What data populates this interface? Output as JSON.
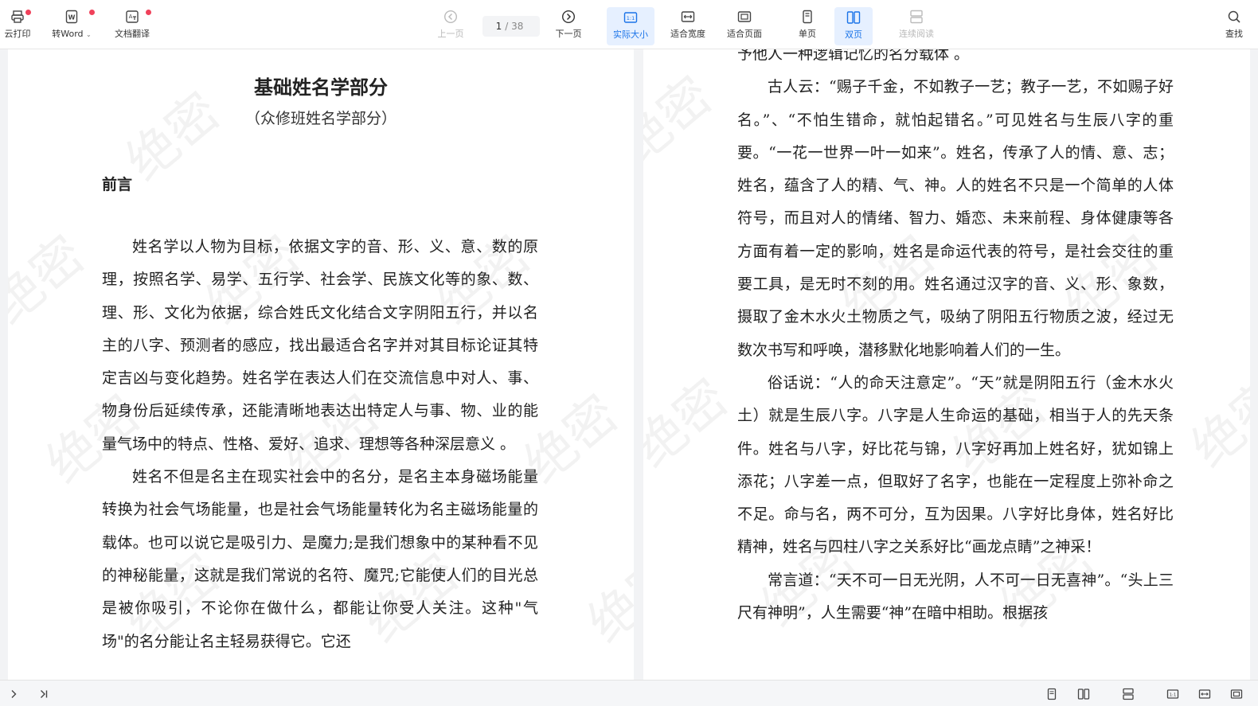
{
  "toolbar": {
    "cloud_print": "云打印",
    "to_word": "转Word",
    "doc_translate": "文档翻译",
    "prev_page": "上一页",
    "current_page": "1",
    "total_pages": "/ 38",
    "next_page": "下一页",
    "actual_size": "实际大小",
    "fit_width": "适合宽度",
    "fit_page": "适合页面",
    "single_page": "单页",
    "double_page": "双页",
    "continuous": "连续阅读",
    "find": "查找"
  },
  "watermark": "绝密",
  "left_page": {
    "title": "基础姓名学部分",
    "subtitle": "（众修班姓名学部分）",
    "heading": "前言",
    "paragraphs": [
      "姓名学以人物为目标，依据文字的音、形、义、意、数的原理，按照名学、易学、五行学、社会学、民族文化等的象、数、理、形、文化为依据，综合姓氏文化结合文字阴阳五行，并以名主的八字、预测者的感应，找出最适合名字并对其目标论证其特定吉凶与变化趋势。姓名学在表达人们在交流信息中对人、事、物身份后延续传承，还能清晰地表达出特定人与事、物、业的能量气场中的特点、性格、爱好、追求、理想等各种深层意义 。",
      "姓名不但是名主在现实社会中的名分，是名主本身磁场能量转换为社会气场能量，也是社会气场能量转化为名主磁场能量的载体。也可以说它是吸引力、是魔力;是我们想象中的某种看不见的神秘能量，这就是我们常说的名符、魔咒;它能使人们的目光总是被你吸引，不论你在做什么，都能让你受人关注。这种\"气场\"的名分能让名主轻易获得它。它还"
    ]
  },
  "right_page": {
    "paragraphs": [
      "予他人一种逻辑记忆的名分载体 。",
      "古人云：“赐子千金，不如教子一艺；教子一艺，不如赐子好名。”、“不怕生错命，就怕起错名。”可见姓名与生辰八字的重要。“一花一世界一叶一如来”。姓名，传承了人的情、意、志；姓名，蕴含了人的精、气、神。人的姓名不只是一个简单的人体符号，而且对人的情绪、智力、婚恋、未来前程、身体健康等各方面有着一定的影响，姓名是命运代表的符号，是社会交往的重要工具，是无时不刻的用。姓名通过汉字的音、义、形、象数，摄取了金木水火土物质之气，吸纳了阴阳五行物质之波，经过无数次书写和呼唤，潜移默化地影响着人们的一生。",
      "俗话说：“人的命天注意定”。“天”就是阴阳五行（金木水火土）就是生辰八字。八字是人生命运的基础，相当于人的先天条件。姓名与八字，好比花与锦，八字好再加上姓名好，犹如锦上添花；八字差一点，但取好了名字，也能在一定程度上弥补命之不足。命与名，两不可分，互为因果。八字好比身体，姓名好比精神，姓名与四柱八字之关系好比“画龙点睛”之神采！",
      "常言道：“天不可一日无光阴，人不可一日无喜神”。“头上三尺有神明”，人生需要“神”在暗中相助。根据孩"
    ]
  },
  "colors": {
    "accent": "#1a73e8",
    "badge": "#f0415a"
  },
  "icons": {
    "cloud_print": "printer-icon",
    "to_word": "word-icon",
    "doc_translate": "translate-icon",
    "prev_page": "left-circle-icon",
    "next_page": "right-circle-icon",
    "actual_size": "actual-size-icon",
    "fit_width": "fit-width-icon",
    "fit_page": "fit-page-icon",
    "single_page": "single-page-icon",
    "double_page": "double-page-icon",
    "continuous": "continuous-icon",
    "find": "search-icon"
  }
}
